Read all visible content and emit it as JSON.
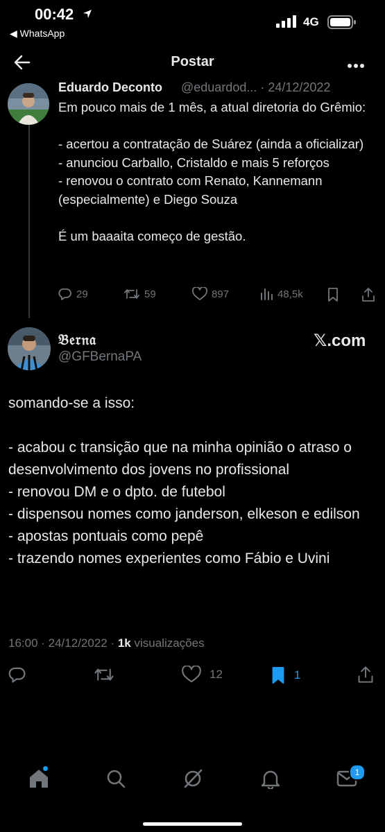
{
  "status_bar": {
    "time": "00:42",
    "back_app": "◀ WhatsApp",
    "network": "4G"
  },
  "header": {
    "title": "Postar"
  },
  "quoted_tweet": {
    "name": "Eduardo Deconto",
    "handle_date": "@eduardod... · 24/12/2022",
    "text": "Em pouco mais de 1 mês, a atual diretoria do Grêmio:\n\n- acertou a contratação de Suárez (ainda a oficializar)\n- anunciou Carballo, Cristaldo e mais 5 reforços\n- renovou o contrato com Renato, Kannemann (especialmente) e Diego Souza\n\nÉ um baaaita começo de gestão.",
    "replies": "29",
    "retweets": "59",
    "likes": "897",
    "views": "48,5k"
  },
  "main_tweet": {
    "name": "𝔅𝔢𝔯𝔫𝔞",
    "handle": "@GFBernaPA",
    "source_logo": "𝕏.com",
    "text": "somando-se a isso:\n\n- acabou c transição que na minha opinião o atraso o desenvolvimento dos jovens no profissional\n- renovou DM e o dpto. de futebol\n- dispensou nomes como janderson, elkeson e edilson\n- apostas pontuais como pepê\n- trazendo nomes experientes como Fábio e Uvini",
    "meta_prefix": "16:00 · 24/12/2022 · ",
    "views_count": "1k",
    "views_label": " visualizações",
    "likes": "12",
    "bookmarks": "1"
  },
  "bottom_nav": {
    "messages_badge": "1"
  },
  "colors": {
    "accent": "#1d9bf0",
    "muted": "#71767b",
    "text": "#e7e9ea",
    "background": "#000000"
  },
  "icons": [
    "location-arrow-icon",
    "signal-icon",
    "battery-icon",
    "back-arrow-icon",
    "more-icon",
    "reply-icon",
    "retweet-icon",
    "like-icon",
    "views-icon",
    "bookmark-icon",
    "share-icon",
    "home-icon",
    "search-icon",
    "grok-icon",
    "notifications-icon",
    "messages-icon"
  ]
}
